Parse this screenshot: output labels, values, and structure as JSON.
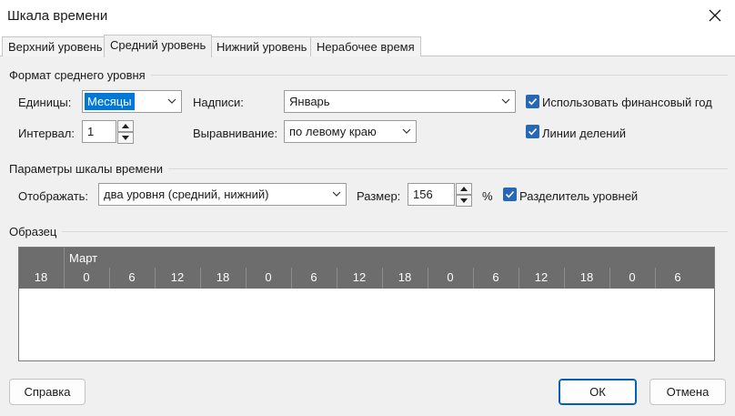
{
  "window": {
    "title": "Шкала времени"
  },
  "tabs": [
    {
      "label": "Верхний уровень"
    },
    {
      "label": "Средний уровень"
    },
    {
      "label": "Нижний уровень"
    },
    {
      "label": "Нерабочее время"
    }
  ],
  "format_group": {
    "title": "Формат среднего уровня",
    "units_label": "Единицы:",
    "units_value": "Месяцы",
    "labels_label": "Надписи:",
    "labels_value": "Январь",
    "fiscal_label": "Использовать финансовый год",
    "fiscal_checked": true,
    "interval_label": "Интервал:",
    "interval_value": "1",
    "align_label": "Выравнивание:",
    "align_value": "по левому краю",
    "tick_lines_label": "Линии делений",
    "tick_lines_checked": true
  },
  "timescale_group": {
    "title": "Параметры шкалы времени",
    "show_label": "Отображать:",
    "show_value": "два уровня (средний, нижний)",
    "size_label": "Размер:",
    "size_value": "156",
    "size_unit": "%",
    "separator_label": "Разделитель уровней",
    "separator_checked": true
  },
  "sample": {
    "title": "Образец",
    "month": "Март",
    "ticks": [
      "18",
      "0",
      "6",
      "12",
      "18",
      "0",
      "6",
      "12",
      "18",
      "0",
      "6",
      "12",
      "18",
      "0",
      "6"
    ]
  },
  "footer": {
    "help_label": "Справка",
    "ok_label": "ОК",
    "cancel_label": "Отмена"
  },
  "colors": {
    "accent": "#2667b6",
    "selection": "#0078d7",
    "scale_bg": "#6d6d6d"
  }
}
